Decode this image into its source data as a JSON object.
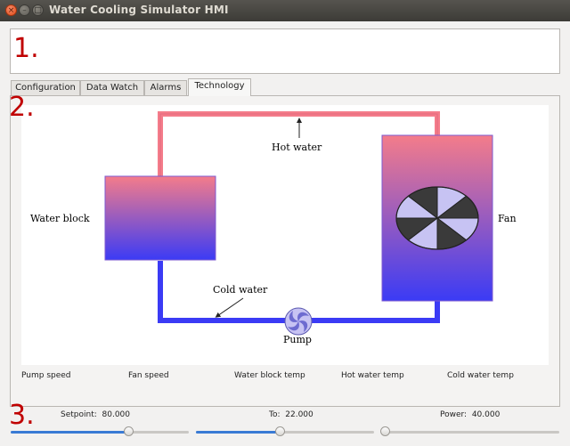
{
  "window": {
    "title": "Water Cooling Simulator HMI",
    "buttons": [
      "×",
      "–",
      "□"
    ]
  },
  "section_numbers": [
    "1.",
    "2.",
    "3."
  ],
  "tabs": [
    {
      "label": "Configuration",
      "active": false
    },
    {
      "label": "Data Watch",
      "active": false
    },
    {
      "label": "Alarms",
      "active": false
    },
    {
      "label": "Technology",
      "active": true
    }
  ],
  "diagram": {
    "labels": {
      "hot_water": "Hot water",
      "cold_water": "Cold water",
      "water_block": "Water block",
      "fan": "Fan",
      "pump": "Pump"
    },
    "colors": {
      "hot": "#f47c8a",
      "cold": "#3b3bf5",
      "fan_light": "#c7c3f3",
      "fan_dark": "#3a3a3a"
    }
  },
  "status_labels": [
    "Pump speed",
    "Fan speed",
    "Water block temp",
    "Hot water temp",
    "Cold water temp"
  ],
  "controls": {
    "setpoint": {
      "label": "Setpoint:",
      "value": "80.000",
      "fraction": 0.66
    },
    "to": {
      "label": "To:",
      "value": "22.000",
      "fraction": 0.47
    },
    "power": {
      "label": "Power:",
      "value": "40.000",
      "fraction": 0.02
    }
  }
}
